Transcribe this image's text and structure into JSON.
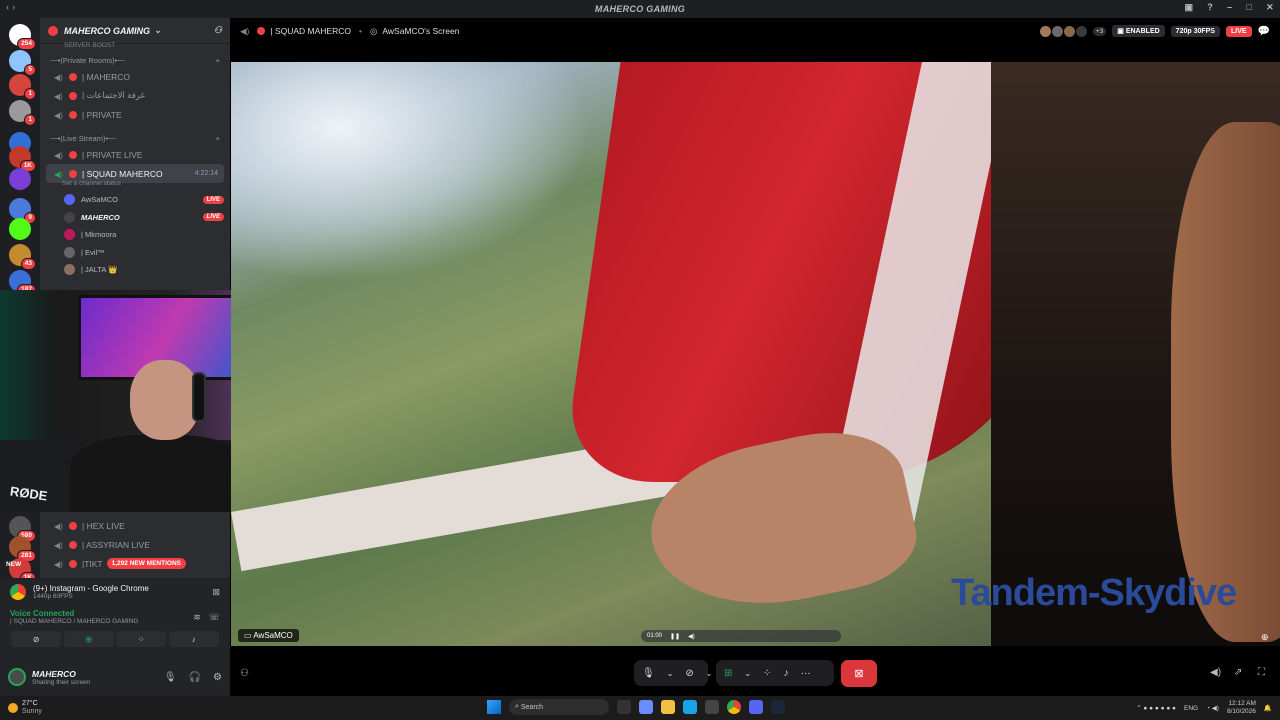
{
  "window": {
    "title": "MAHERCO GAMING"
  },
  "servers": [
    {
      "badge": "254",
      "color": "#ffffff"
    },
    {
      "badge": "5",
      "color": "#8ec5ff"
    },
    {
      "badge": "1",
      "color": "#d6453d"
    },
    {
      "badge": "1",
      "color": "#9a9a9a"
    },
    {
      "badge": "",
      "color": "#2f6fd6"
    },
    {
      "badge": "1K",
      "color": "#c0392b"
    },
    {
      "badge": "",
      "color": "#7b3fd6"
    },
    {
      "badge": "9",
      "color": "#4a7bd8"
    },
    {
      "badge": "",
      "color": "#53fc18"
    },
    {
      "badge": "43",
      "color": "#c48a2e"
    },
    {
      "badge": "187",
      "color": "#3b6fd8"
    },
    {
      "badge": "580",
      "color": "#555555"
    },
    {
      "badge": "281",
      "color": "#a0522d"
    },
    {
      "badge": "1K",
      "color": "#d13b3b",
      "label": "NEW"
    }
  ],
  "sidebar": {
    "guild_name": "MAHERCO GAMING",
    "top_cutoff": "SERVER BOOST",
    "categories": [
      {
        "label": "-─•(Private Rooms)•─-"
      },
      {
        "label": "-─•(Live Stream)•─-"
      }
    ],
    "private_channels": [
      "| MAHERCO",
      "| غرفة الاجتماعات",
      "| PRIVATE"
    ],
    "live_channels": [
      "| PRIVATE LIVE"
    ],
    "active_channel": {
      "name": "| SQUAD MAHERCO",
      "time": "4:22:14",
      "status": "Set a channel status"
    },
    "members": [
      {
        "name": "AwSaMCO",
        "live": "LIVE",
        "color": "#5865f2"
      },
      {
        "name": "MAHERCO",
        "live": "LIVE",
        "color": "#444444",
        "bold": true
      },
      {
        "name": "| Mkmoora",
        "live": "",
        "color": "#c2185b"
      },
      {
        "name": "| Evil™",
        "live": "",
        "color": "#666666"
      },
      {
        "name": "| JALTA 👑",
        "live": "",
        "color": "#8d6e63"
      }
    ],
    "lower_channels": [
      {
        "name": "| HEX LIVE"
      },
      {
        "name": "| ASSYRIAN LIVE"
      },
      {
        "name": "|TIKT",
        "mentions": "1,292 NEW MENTIONS"
      }
    ]
  },
  "screenshare_panel": {
    "title": "(9+) Instagram - Google Chrome",
    "sub": "1440p 60FPS",
    "voice_status": "Voice Connected",
    "voice_channel": "| SQUAD MAHERCO / MAHERCO GAMING"
  },
  "user": {
    "name": "MAHERCO",
    "status": "Sharing their screen"
  },
  "topbar": {
    "channel": "| SQUAD MAHERCO",
    "screen_label": "AwSaMCO's Screen",
    "extra_viewers": "+3",
    "enabled_label": "ENABLED",
    "quality": "720p 30FPS",
    "live": "LIVE"
  },
  "stream": {
    "watermark": "Tandem-Skydive",
    "streamer_label": "AwSaMCO",
    "video_time": "01:00"
  },
  "taskbar": {
    "temp": "27°C",
    "weather": "Sunny",
    "search_placeholder": "Search",
    "lang": "ENG",
    "time": "12:12 AM",
    "date": "8/10/2026"
  }
}
